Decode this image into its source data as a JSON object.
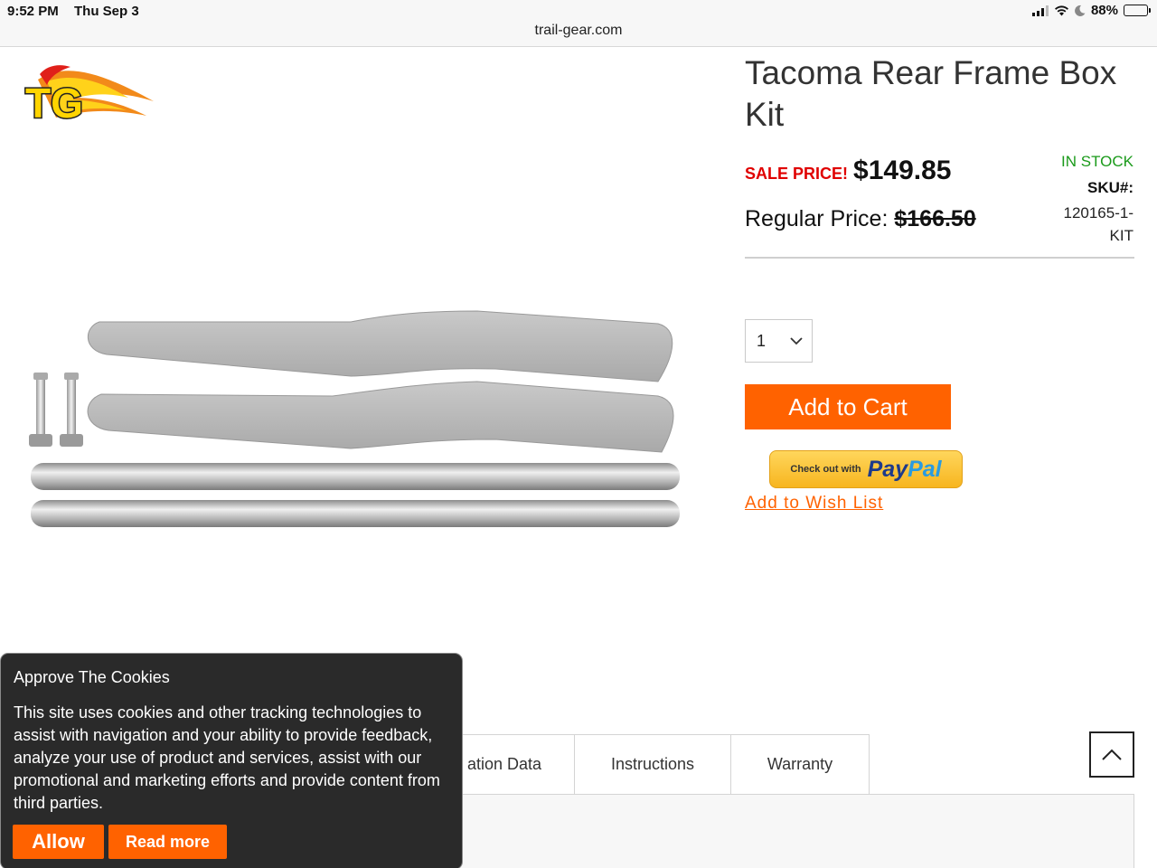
{
  "status_bar": {
    "time": "9:52 PM",
    "date": "Thu Sep 3",
    "battery": "88%",
    "battery_level": 0.88
  },
  "browser": {
    "url": "trail-gear.com"
  },
  "logo": {
    "text": "TG"
  },
  "product": {
    "title": "Tacoma Rear Frame Box Kit",
    "sale_label": "SALE PRICE!",
    "sale_price": "$149.85",
    "regular_label": "Regular Price:",
    "regular_price": "$166.50",
    "stock_status": "IN STOCK",
    "sku_label": "SKU#:",
    "sku_value": "120165-1-KIT",
    "quantity": "1",
    "add_to_cart": "Add to Cart",
    "paypal_small": "Check out with",
    "paypal_pay": "Pay",
    "paypal_pal": "Pal",
    "wishlist": "Add to Wish List"
  },
  "tabs": [
    {
      "label": "ation Data"
    },
    {
      "label": "Instructions"
    },
    {
      "label": "Warranty"
    }
  ],
  "cookie": {
    "title": "Approve The Cookies",
    "text": "This site uses cookies and other tracking technologies to assist with navigation and your ability to provide feedback, analyze your use of product and services, assist with our promotional and marketing efforts and provide content from third parties.",
    "allow": "Allow",
    "read_more": "Read more"
  },
  "colors": {
    "accent": "#ff6200",
    "sale": "#e00000",
    "stock": "#1a9a1a"
  }
}
